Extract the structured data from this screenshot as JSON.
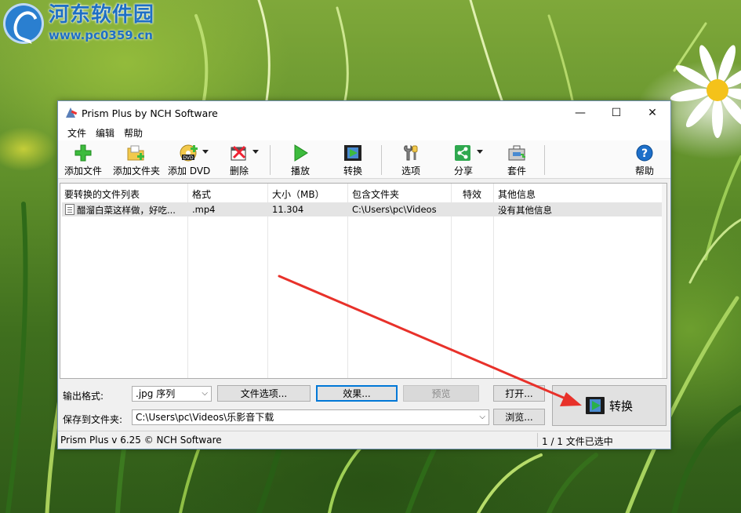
{
  "watermark": {
    "title": "河东软件园",
    "url": "www.pc0359.cn"
  },
  "window": {
    "title": "Prism Plus by NCH Software",
    "controls": {
      "minimize": "—",
      "maximize": "☐",
      "close": "✕"
    }
  },
  "menu": [
    "文件",
    "编辑",
    "帮助"
  ],
  "toolbar": {
    "add_file": "添加文件",
    "add_folder": "添加文件夹",
    "add_dvd": "添加 DVD",
    "delete": "删除",
    "play": "播放",
    "convert": "转换",
    "options": "选项",
    "share": "分享",
    "suite": "套件",
    "help": "帮助",
    "dvd_badge": "DVD"
  },
  "file_list": {
    "columns": [
      "要转换的文件列表",
      "格式",
      "大小（MB）",
      "包含文件夹",
      "特效",
      "其他信息"
    ],
    "rows": [
      {
        "name": "醋溜白菜这样做，好吃...",
        "format": ".mp4",
        "size": "11.304",
        "folder": "C:\\Users\\pc\\Videos",
        "effects": "",
        "info": "没有其他信息"
      }
    ]
  },
  "output": {
    "format_label": "输出格式:",
    "format_value": ".jpg 序列",
    "file_options": "文件选项...",
    "effects": "效果...",
    "preview": "预览",
    "open": "打开...",
    "save_label": "保存到文件夹:",
    "save_path": "C:\\Users\\pc\\Videos\\乐影音下载",
    "browse": "浏览...",
    "convert_button": "转换"
  },
  "status": {
    "version": "Prism Plus v 6.25 © NCH Software",
    "selection": "1 / 1 文件已选中"
  },
  "colors": {
    "arrow": "#e8312a",
    "focus": "#0078d7",
    "row_highlight": "#e4e4e4"
  }
}
